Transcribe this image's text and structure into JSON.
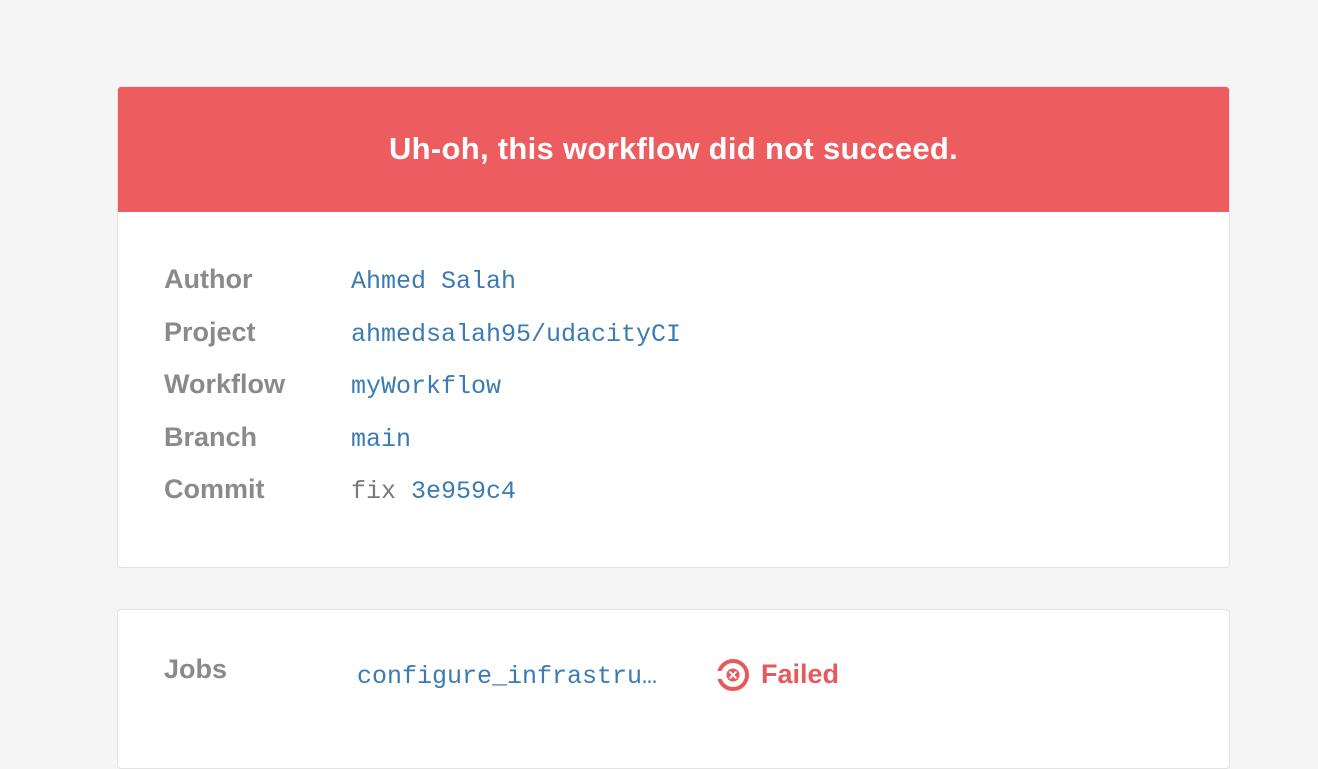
{
  "banner": {
    "title": "Uh-oh, this workflow did not succeed.",
    "color": "#ed5c5f"
  },
  "details": {
    "author": {
      "label": "Author",
      "value": "Ahmed Salah"
    },
    "project": {
      "label": "Project",
      "value": "ahmedsalah95/udacityCI"
    },
    "workflow": {
      "label": "Workflow",
      "value": "myWorkflow"
    },
    "branch": {
      "label": "Branch",
      "value": "main"
    },
    "commit": {
      "label": "Commit",
      "message": "fix",
      "sha": "3e959c4"
    }
  },
  "jobs": {
    "label": "Jobs",
    "items": [
      {
        "name": "configure_infrastru…",
        "status": "Failed",
        "status_icon": "failed-circle-icon",
        "status_color": "#e55a5d"
      }
    ]
  },
  "colors": {
    "link": "#3a7bb3",
    "label": "#8a8a8a",
    "background": "#f5f5f5"
  }
}
